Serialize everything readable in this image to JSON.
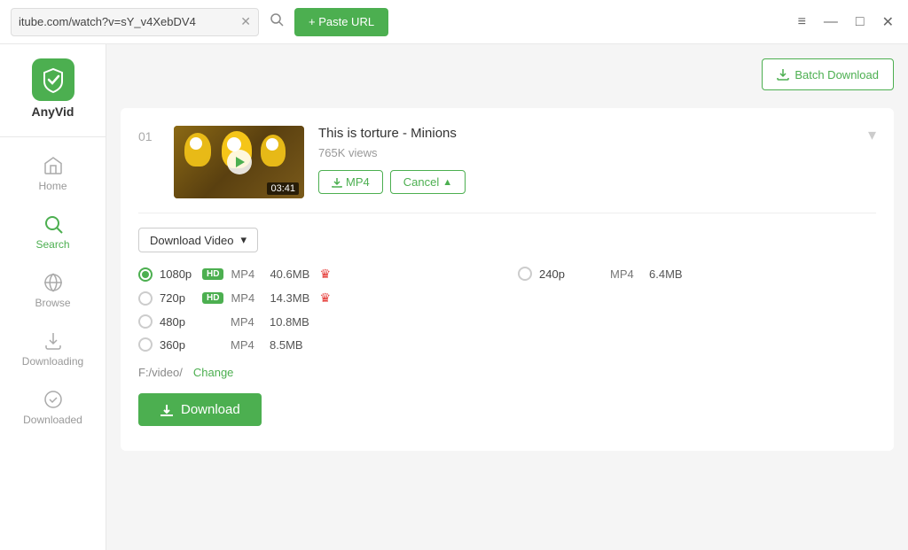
{
  "app": {
    "name": "AnyVid",
    "logo_text": "A"
  },
  "titlebar": {
    "url": "itube.com/watch?v=sY_v4XebDV4",
    "paste_btn": "+ Paste URL",
    "menu_icon": "≡",
    "minimize_icon": "—",
    "maximize_icon": "□",
    "close_icon": "✕"
  },
  "sidebar": {
    "items": [
      {
        "id": "home",
        "label": "Home",
        "icon": "home"
      },
      {
        "id": "search",
        "label": "Search",
        "icon": "search",
        "active": true
      },
      {
        "id": "browse",
        "label": "Browse",
        "icon": "browse"
      },
      {
        "id": "downloading",
        "label": "Downloading",
        "icon": "downloading"
      },
      {
        "id": "downloaded",
        "label": "Downloaded",
        "icon": "downloaded"
      }
    ]
  },
  "header": {
    "batch_download_btn": "Batch Download"
  },
  "video": {
    "number": "01",
    "title": "This is torture - Minions",
    "views": "765K views",
    "duration": "03:41",
    "mp4_btn": "MP4",
    "cancel_btn": "Cancel"
  },
  "format_section": {
    "dropdown_label": "Download Video",
    "options": [
      {
        "res": "1080p",
        "hd": true,
        "format": "MP4",
        "size": "40.6MB",
        "crown": true,
        "selected": true
      },
      {
        "res": "720p",
        "hd": true,
        "format": "MP4",
        "size": "14.3MB",
        "crown": true,
        "selected": false
      },
      {
        "res": "480p",
        "hd": false,
        "format": "MP4",
        "size": "10.8MB",
        "crown": false,
        "selected": false
      },
      {
        "res": "360p",
        "hd": false,
        "format": "MP4",
        "size": "8.5MB",
        "crown": false,
        "selected": false
      }
    ],
    "options_right": [
      {
        "res": "240p",
        "hd": false,
        "format": "MP4",
        "size": "6.4MB",
        "crown": false,
        "selected": false
      }
    ],
    "save_path": "F:/video/",
    "change_label": "Change",
    "download_btn": "Download"
  }
}
